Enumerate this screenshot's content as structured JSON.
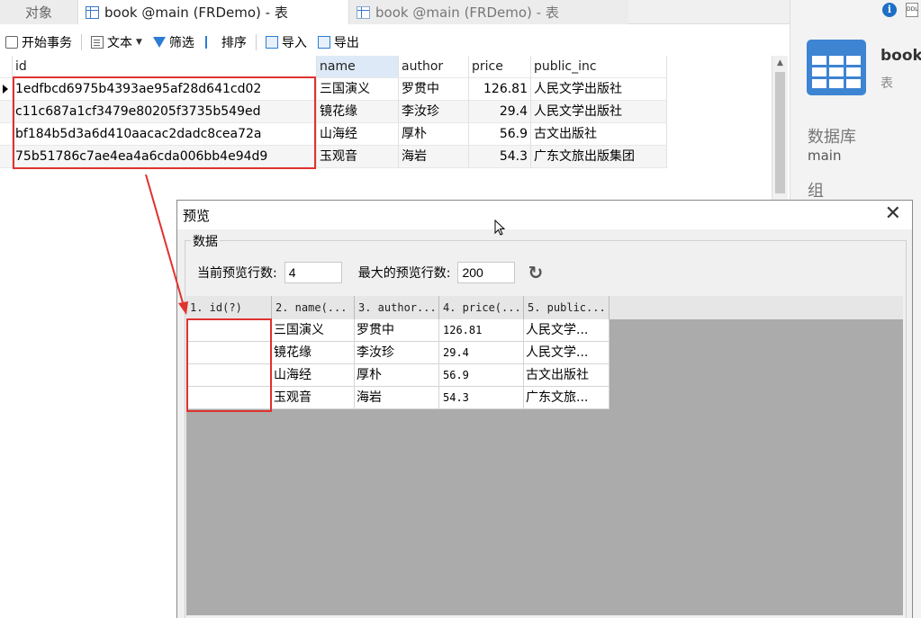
{
  "tabs": {
    "objects": "对象",
    "active": "book @main (FRDemo) - 表",
    "inactive": "book @main (FRDemo) - 表"
  },
  "toolbar": {
    "begin_transaction": "开始事务",
    "text": "文本",
    "filter": "筛选",
    "sort": "排序",
    "import": "导入",
    "export": "导出"
  },
  "grid": {
    "columns": [
      "id",
      "name",
      "author",
      "price",
      "public_inc"
    ],
    "rows": [
      [
        "1edfbcd6975b4393ae95af28d641cd02",
        "三国演义",
        "罗贯中",
        "126.81",
        "人民文学出版社"
      ],
      [
        "c11c687a1cf3479e80205f3735b549ed",
        "镜花缘",
        "李汝珍",
        "29.4",
        "人民文学出版社"
      ],
      [
        "bf184b5d3a6d410aacac2dadc8cea72a",
        "山海经",
        "厚朴",
        "56.9",
        "古文出版社"
      ],
      [
        "75b51786c7ae4ea4a6cda006bb4e94d9",
        "玉观音",
        "海岩",
        "54.3",
        "广东文旅出版集团"
      ]
    ]
  },
  "right_panel": {
    "object_name": "book",
    "object_type": "表",
    "db_label": "数据库",
    "db_value": "main",
    "group_label": "组",
    "info_icon": "i",
    "ddl_icon": "DDL"
  },
  "dialog": {
    "title": "预览",
    "legend": "数据",
    "current_rows_label": "当前预览行数:",
    "current_rows_value": "4",
    "max_rows_label": "最大的预览行数:",
    "max_rows_value": "200",
    "columns": [
      "1. id(?)",
      "2. name(...",
      "3. author...",
      "4. price(...",
      "5. public..."
    ],
    "rows": [
      [
        "",
        "三国演义",
        "罗贯中",
        "126.81",
        "人民文学..."
      ],
      [
        "",
        "镜花缘",
        "李汝珍",
        "29.4",
        "人民文学..."
      ],
      [
        "",
        "山海经",
        "厚朴",
        "56.9",
        "古文出版社"
      ],
      [
        "",
        "玉观音",
        "海岩",
        "54.3",
        "广东文旅..."
      ]
    ]
  },
  "colors": {
    "highlight_red": "#e0322f",
    "accent_blue": "#3d84d3"
  }
}
